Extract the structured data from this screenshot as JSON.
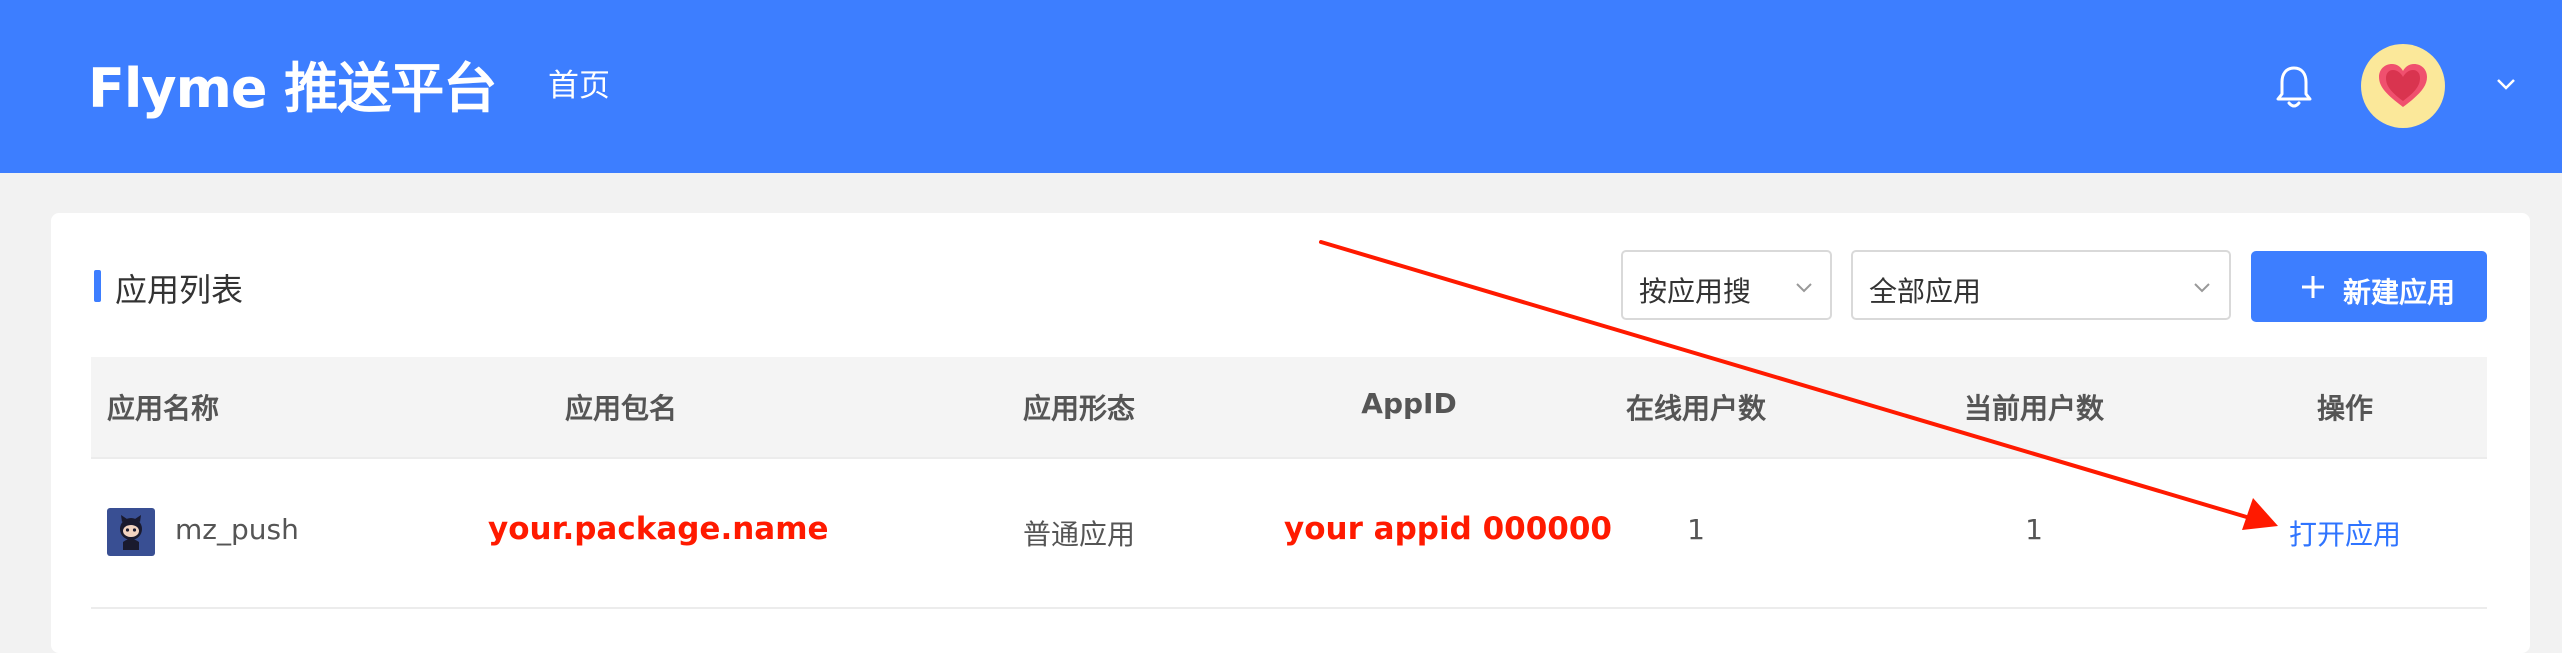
{
  "header": {
    "logo": "Flyme 推送平台",
    "nav_home": "首页",
    "bell_icon": "bell-icon",
    "avatar_icon": "heart-avatar-icon",
    "user_menu_icon": "chevron-down-icon"
  },
  "panel": {
    "title": "应用列表",
    "search_type_select": {
      "value": "按应用搜",
      "icon": "chevron-down-icon"
    },
    "app_filter_select": {
      "value": "全部应用",
      "icon": "chevron-down-icon"
    },
    "new_app_button": {
      "label": "新建应用",
      "icon": "plus-icon"
    }
  },
  "table": {
    "columns": [
      "应用名称",
      "应用包名",
      "应用形态",
      "AppID",
      "在线用户数",
      "当前用户数",
      "操作"
    ],
    "rows": [
      {
        "app_name": "mz_push",
        "package_name": "your.package.name",
        "app_type": "普通应用",
        "app_id": "your appid 000000",
        "online_users": "1",
        "current_users": "1",
        "action": "打开应用"
      }
    ]
  },
  "colors": {
    "brand_blue": "#3d7eff",
    "annotation_red": "#ff1a00",
    "link_blue": "#2f74ff"
  }
}
